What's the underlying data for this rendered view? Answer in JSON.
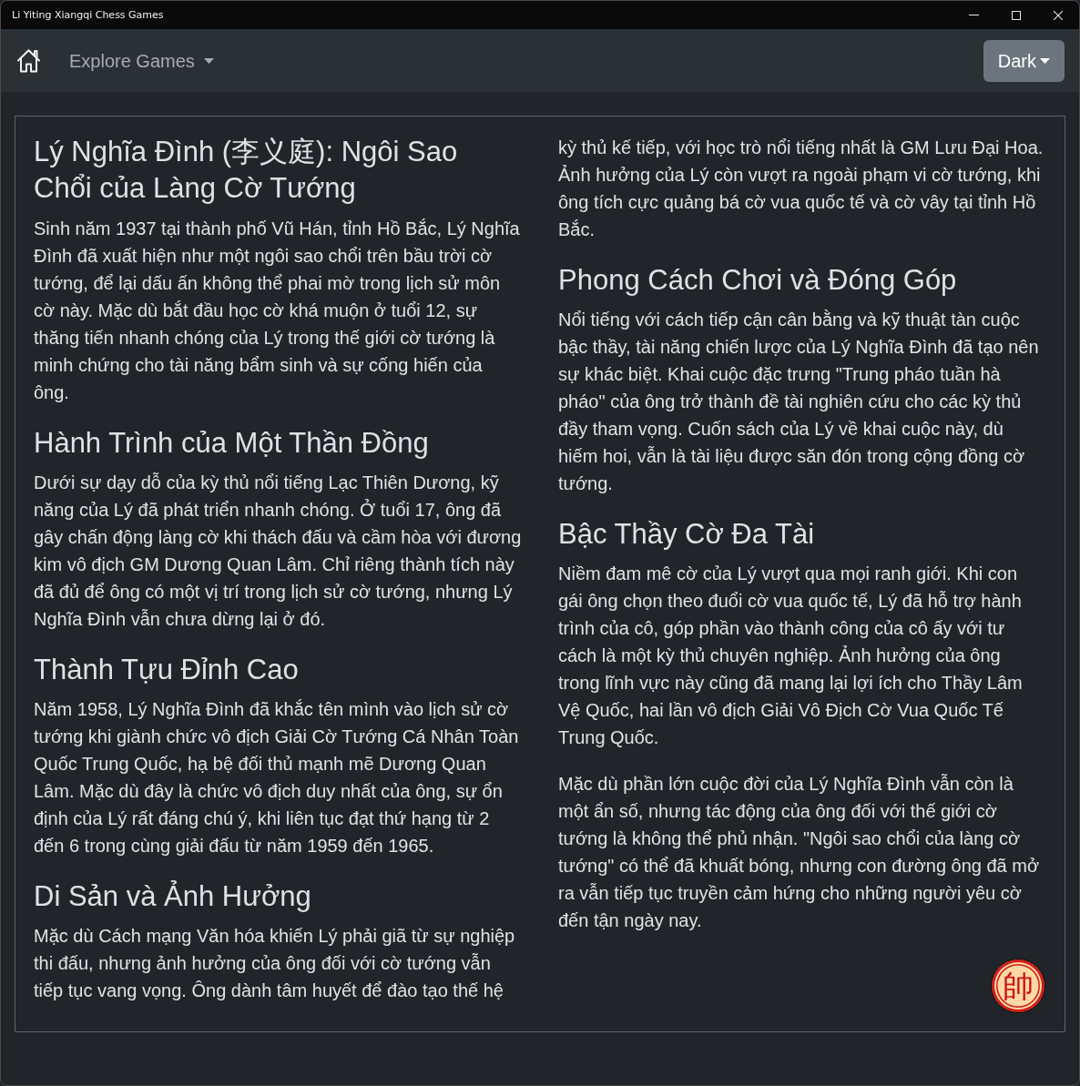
{
  "window": {
    "title": "Li Yiting Xiangqi Chess Games"
  },
  "navbar": {
    "menu": {
      "label": "Explore Games"
    },
    "theme_button": {
      "label": "Dark"
    }
  },
  "article": {
    "columns": [
      {
        "blocks": [
          {
            "kind": "title",
            "text": "Lý Nghĩa Đình (李义庭): Ngôi Sao Chổi của Làng Cờ Tướng"
          },
          {
            "kind": "paragraph",
            "text": "Sinh năm 1937 tại thành phố Vũ Hán, tỉnh Hồ Bắc, Lý Nghĩa Đình đã xuất hiện như một ngôi sao chổi trên bầu trời cờ tướng, để lại dấu ấn không thể phai mờ trong lịch sử môn cờ này. Mặc dù bắt đầu học cờ khá muộn ở tuổi 12, sự thăng tiến nhanh chóng của Lý trong thế giới cờ tướng là minh chứng cho tài năng bẩm sinh và sự cống hiến của ông."
          },
          {
            "kind": "heading",
            "text": "Hành Trình của Một Thần Đồng"
          },
          {
            "kind": "paragraph",
            "text": "Dưới sự dạy dỗ của kỳ thủ nổi tiếng Lạc Thiên Dương, kỹ năng của Lý đã phát triển nhanh chóng. Ở tuổi 17, ông đã gây chấn động làng cờ khi thách đấu và cầm hòa với đương kim vô địch GM Dương Quan Lâm. Chỉ riêng thành tích này đã đủ để ông có một vị trí trong lịch sử cờ tướng, nhưng Lý Nghĩa Đình vẫn chưa dừng lại ở đó."
          },
          {
            "kind": "heading",
            "text": "Thành Tựu Đỉnh Cao"
          },
          {
            "kind": "paragraph",
            "text": "Năm 1958, Lý Nghĩa Đình đã khắc tên mình vào lịch sử cờ tướng khi giành chức vô địch Giải Cờ Tướng Cá Nhân Toàn Quốc Trung Quốc, hạ bệ đối thủ mạnh mẽ Dương Quan Lâm. Mặc dù đây là chức vô địch duy nhất của ông, sự ổn định của Lý rất đáng chú ý, khi liên tục đạt thứ hạng từ 2 đến 6 trong cùng giải đấu từ năm 1959 đến 1965."
          },
          {
            "kind": "heading",
            "text": "Di Sản và Ảnh Hưởng"
          },
          {
            "kind": "paragraph",
            "text": "Mặc dù Cách mạng Văn hóa khiến Lý phải giã từ sự nghiệp thi đấu, nhưng ảnh hưởng của ông đối với cờ tướng vẫn tiếp tục vang vọng. Ông dành tâm huyết để đào tạo thế hệ"
          }
        ]
      },
      {
        "blocks": [
          {
            "kind": "paragraph",
            "text": "kỳ thủ kế tiếp, với học trò nổi tiếng nhất là GM Lưu Đại Hoa. Ảnh hưởng của Lý còn vượt ra ngoài phạm vi cờ tướng, khi ông tích cực quảng bá cờ vua quốc tế và cờ vây tại tỉnh Hồ Bắc."
          },
          {
            "kind": "heading",
            "text": "Phong Cách Chơi và Đóng Góp"
          },
          {
            "kind": "paragraph",
            "text": "Nổi tiếng với cách tiếp cận cân bằng và kỹ thuật tàn cuộc bậc thầy, tài năng chiến lược của Lý Nghĩa Đình đã tạo nên sự khác biệt. Khai cuộc đặc trưng \"Trung pháo tuần hà pháo\" của ông trở thành đề tài nghiên cứu cho các kỳ thủ đầy tham vọng. Cuốn sách của Lý về khai cuộc này, dù hiếm hoi, vẫn là tài liệu được săn đón trong cộng đồng cờ tướng."
          },
          {
            "kind": "heading",
            "text": "Bậc Thầy Cờ Đa Tài"
          },
          {
            "kind": "paragraph",
            "text": "Niềm đam mê cờ của Lý vượt qua mọi ranh giới. Khi con gái ông chọn theo đuổi cờ vua quốc tế, Lý đã hỗ trợ hành trình của cô, góp phần vào thành công của cô ấy với tư cách là một kỳ thủ chuyên nghiệp. Ảnh hưởng của ông trong lĩnh vực này cũng đã mang lại lợi ích cho Thầy Lâm Vệ Quốc, hai lần vô địch Giải Vô Địch Cờ Vua Quốc Tế Trung Quốc."
          },
          {
            "kind": "paragraph",
            "text": "Mặc dù phần lớn cuộc đời của Lý Nghĩa Đình vẫn còn là một ẩn số, nhưng tác động của ông đối với thế giới cờ tướng là không thể phủ nhận. \"Ngôi sao chổi của làng cờ tướng\" có thể đã khuất bóng, nhưng con đường ông đã mở ra vẫn tiếp tục truyền cảm hứng cho những người yêu cờ đến tận ngày nay."
          }
        ]
      }
    ]
  },
  "piece_button": {
    "glyph": "帥"
  }
}
